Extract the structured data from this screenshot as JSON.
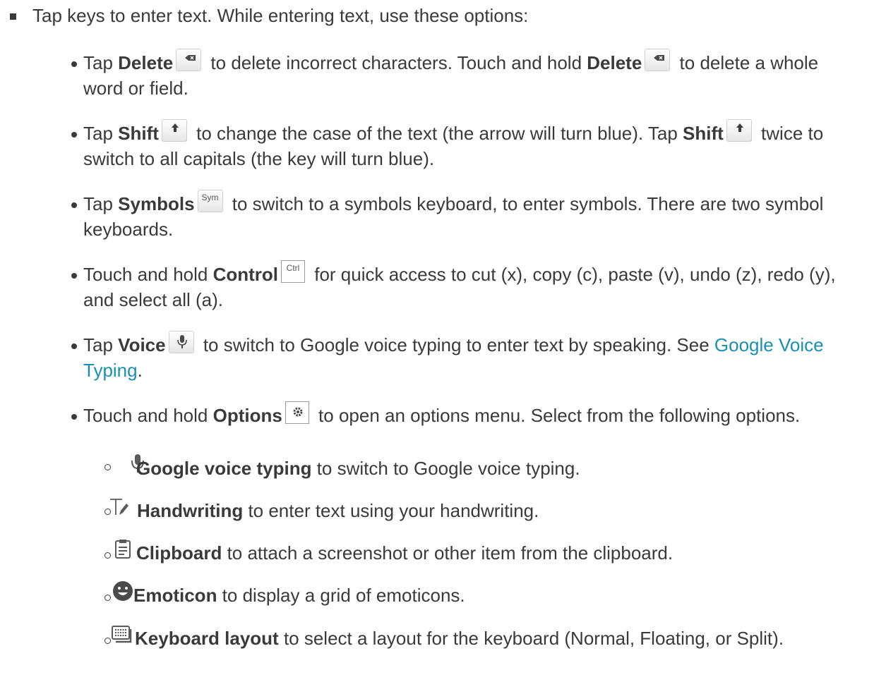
{
  "intro": "Tap keys to enter text. While entering text, use these options:",
  "items": [
    {
      "pre": "Tap ",
      "bold": "Delete",
      "key": "backspace-key-icon",
      "mid": " to delete incorrect characters. Touch and hold ",
      "bold2": "Delete",
      "post1": " to delete a whole",
      "post2": "word or field."
    },
    {
      "pre": "Tap ",
      "bold": "Shift",
      "key": "shift-key-icon",
      "mid": " to change the case of the text (the arrow will turn blue). Tap ",
      "bold2": "Shift",
      "post1": " twice to",
      "post2": "switch to all capitals (the key will turn blue)."
    },
    {
      "pre": "Tap ",
      "bold": "Symbols",
      "key_label": "Sym",
      "post1": " to switch to a symbols keyboard, to enter symbols. There are two symbol",
      "post2": "keyboards."
    },
    {
      "pre": "Touch and hold ",
      "bold": "Control",
      "key_label": "Ctrl",
      "post1": " for quick access to cut (x), copy (c), paste (v), undo (z), redo (y),",
      "post2": "and select all (a)."
    },
    {
      "pre": "Tap ",
      "bold": "Voice",
      "key": "mic-key-icon",
      "post1": " to switch to Google voice typing to enter text by speaking. See ",
      "link1": "Google Voice",
      "link2": "Typing",
      "post2": "."
    },
    {
      "pre": "Touch and hold ",
      "bold": "Options",
      "key": "gear-key-icon",
      "post1": " to open an options menu. Select from the following options."
    }
  ],
  "subitems": [
    {
      "icon": "mic-icon",
      "bold": "Google voice typing",
      "text": " to switch to Google voice typing."
    },
    {
      "icon": "handwriting-icon",
      "bold": "Handwriting",
      "text": " to enter text using your handwriting."
    },
    {
      "icon": "clipboard-icon",
      "bold": "Clipboard",
      "text": " to attach a screenshot or other item from the clipboard."
    },
    {
      "icon": "emoticon-icon",
      "bold": "Emoticon",
      "text": " to display a grid of emoticons."
    },
    {
      "icon": "keyboard-icon",
      "bold": "Keyboard layout",
      "text": " to select a layout for the keyboard (Normal, Floating, or Split)."
    }
  ],
  "colors": {
    "text": "#3a3a3a",
    "link": "#1a8fb5"
  }
}
